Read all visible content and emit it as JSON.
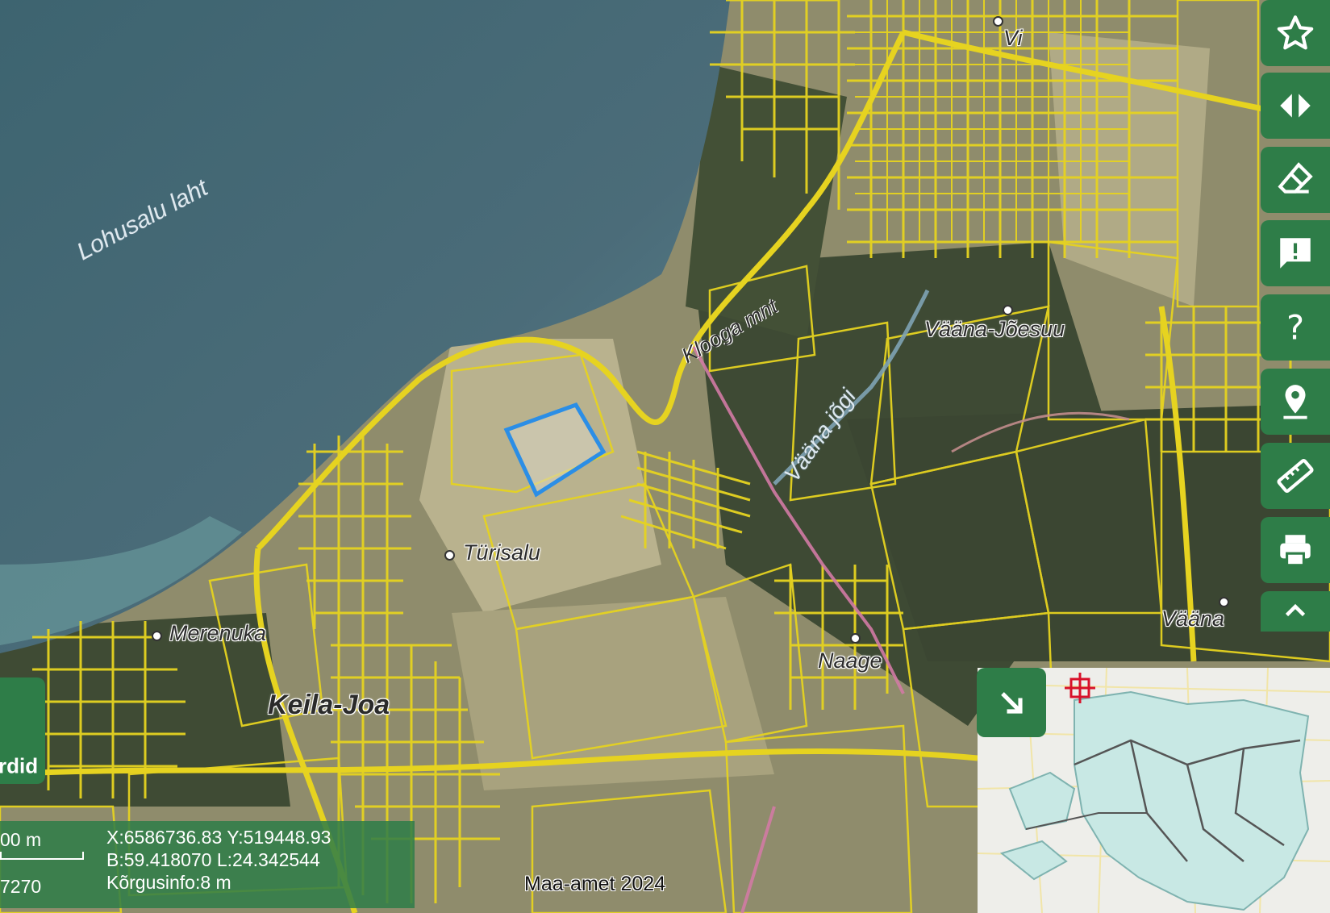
{
  "map": {
    "water_label": "Lohusalu laht",
    "places": [
      {
        "name": "Türisalu"
      },
      {
        "name": "Merenuka"
      },
      {
        "name": "Keila-Joa"
      },
      {
        "name": "Vääna-Jõesuu"
      },
      {
        "name": "Vääna"
      },
      {
        "name": "Naage"
      },
      {
        "name": "Vi"
      }
    ],
    "river_label": "Vääna jõgi",
    "road_label": "Klooga mnt"
  },
  "toolbar": {
    "buttons": [
      {
        "name": "favorite",
        "icon": "star-icon"
      },
      {
        "name": "compare",
        "icon": "split-arrows-icon"
      },
      {
        "name": "eraser",
        "icon": "eraser-icon"
      },
      {
        "name": "feedback",
        "icon": "comment-alert-icon"
      },
      {
        "name": "help",
        "icon": "question-icon"
      },
      {
        "name": "location",
        "icon": "map-pin-icon"
      },
      {
        "name": "measure",
        "icon": "ruler-icon"
      },
      {
        "name": "print",
        "icon": "printer-icon"
      },
      {
        "name": "collapse",
        "icon": "chevron-up-icon"
      }
    ]
  },
  "coordinates": {
    "line1": "X:6586736.83 Y:519448.93",
    "line2": "B:59.418070 L:24.342544",
    "line3": "Kõrgusinfo:8 m"
  },
  "scale": {
    "distance": "00 m",
    "ratio": "7270"
  },
  "left_panel": {
    "label": "rdid"
  },
  "attribution": "Maa-amet 2024",
  "colors": {
    "accent": "#2e7d48",
    "parcel": "#e6d320",
    "selection": "#2b8ee6",
    "sea": "#466a78"
  }
}
